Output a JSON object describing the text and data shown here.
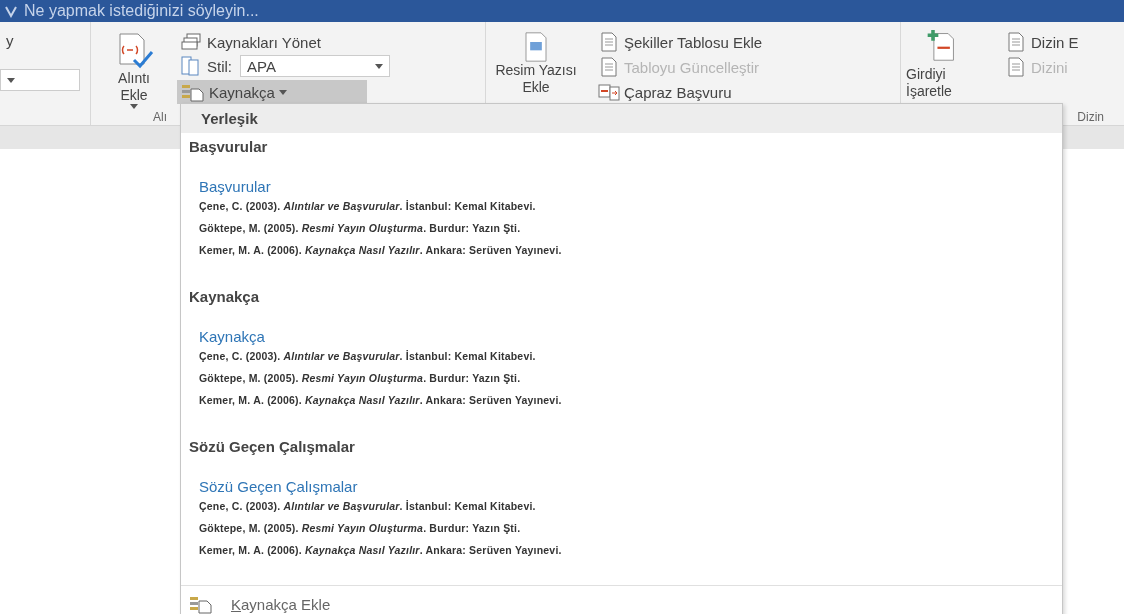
{
  "tell_me": {
    "placeholder": "Ne yapmak istediğinizi söyleyin..."
  },
  "ribbon": {
    "clipped_label": "y",
    "citations": {
      "insert_citation": "Alıntı Ekle",
      "manage_sources": "Kaynakları Yönet",
      "style": {
        "label": "Stil:",
        "value": "APA"
      },
      "bibliography": {
        "label": "Kaynakça",
        "selected": true
      },
      "group_label": "Alı"
    },
    "captions": {
      "insert_caption": "Resim Yazısı Ekle",
      "items": [
        {
          "label": "Şekiller Tablosu Ekle",
          "disabled": false
        },
        {
          "label": "Tabloyu Güncelleştir",
          "disabled": true
        },
        {
          "label": "Çapraz Başvuru",
          "disabled": false
        }
      ]
    },
    "index": {
      "mark_entry": "Girdiyi İşaretle",
      "items": [
        {
          "label": "Dizin E",
          "disabled": false
        },
        {
          "label": "Dizini",
          "disabled": true
        }
      ],
      "group_label": "Dizin"
    }
  },
  "bibliography_menu": {
    "header": "Yerleşik",
    "sections": [
      {
        "heading": "Başvurular",
        "title": "Başvurular",
        "entries": [
          "Çene, C. (2003). *Alıntılar ve Başvurular*. İstanbul: Kemal Kitabevi.",
          "Göktepe, M. (2005). *Resmi Yayın Oluşturma*. Burdur: Yazın Şti.",
          "Kemer, M. A. (2006). *Kaynakça Nasıl Yazılır*. Ankara: Serüven Yayınevi."
        ]
      },
      {
        "heading": "Kaynakça",
        "title": "Kaynakça",
        "entries": [
          "Çene, C. (2003). *Alıntılar ve Başvurular*. İstanbul: Kemal Kitabevi.",
          "Göktepe, M. (2005). *Resmi Yayın Oluşturma*. Burdur: Yazın Şti.",
          "Kemer, M. A. (2006). *Kaynakça Nasıl Yazılır*. Ankara: Serüven Yayınevi."
        ]
      },
      {
        "heading": "Sözü Geçen Çalışmalar",
        "title": "Sözü Geçen Çalışmalar",
        "entries": [
          "Çene, C. (2003). *Alıntılar ve Başvurular*. İstanbul: Kemal Kitabevi.",
          "Göktepe, M. (2005). *Resmi Yayın Oluşturma*. Burdur: Yazın Şti.",
          "Kemer, M. A. (2006). *Kaynakça Nasıl Yazılır*. Ankara: Serüven Yayınevi."
        ]
      }
    ],
    "footer": {
      "label": "Kaynakça Ekle"
    }
  }
}
